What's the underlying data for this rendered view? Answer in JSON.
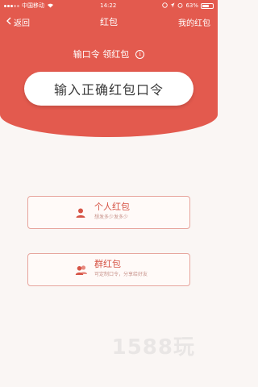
{
  "status_bar": {
    "carrier": "中国移动",
    "time": "14:22",
    "battery_percent_text": "63%",
    "battery_level": 0.63
  },
  "nav": {
    "back_label": "返回",
    "title": "红包",
    "right_label": "我的红包"
  },
  "header": {
    "subtitle": "输口令 领红包",
    "info_icon_glyph": "i",
    "code_button_label": "输入正确红包口令"
  },
  "options": {
    "personal": {
      "title": "个人红包",
      "subtitle": "想发多少发多少",
      "icon": "person-icon"
    },
    "group": {
      "title": "群红包",
      "subtitle": "可定制口令，分享给好友",
      "icon": "group-icon"
    }
  },
  "watermark": "1588玩",
  "colors": {
    "accent": "#e35a4e",
    "card_border": "#e7a59d",
    "card_text": "#d65446",
    "background": "#faf6f4"
  }
}
